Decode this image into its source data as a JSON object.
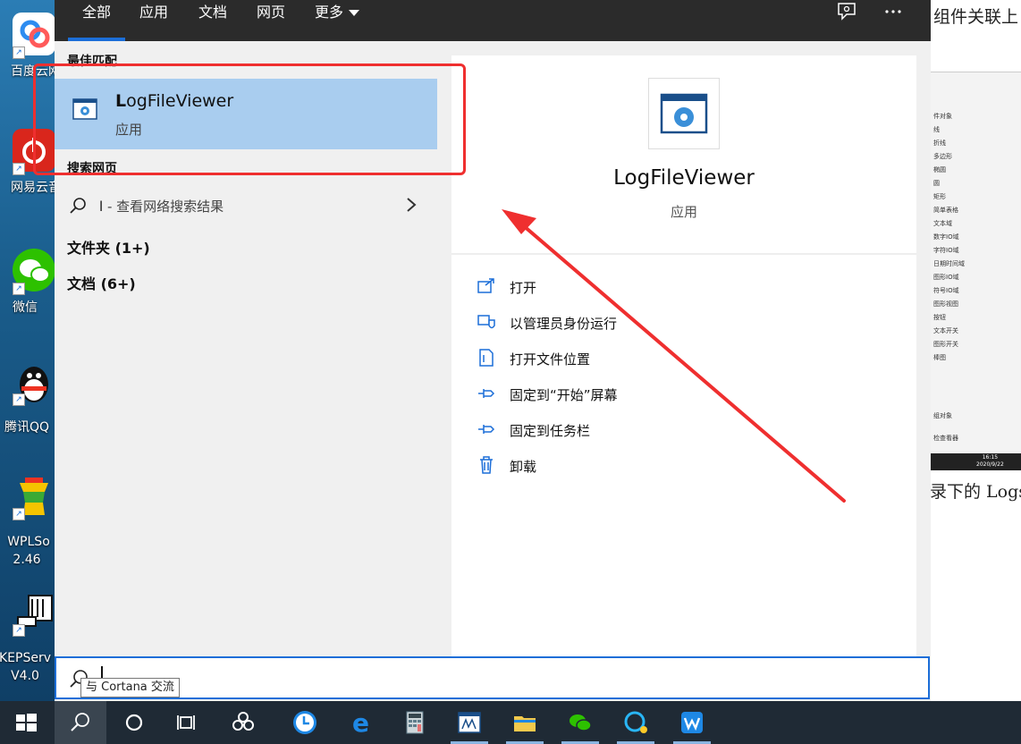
{
  "desktop_icons": [
    {
      "label": "百度云网",
      "icon": "baidu-netdisk-icon",
      "color": "#2d8cf0"
    },
    {
      "label": "网易云音",
      "icon": "netease-music-icon",
      "color": "#d9261c"
    },
    {
      "label": "微信",
      "icon": "wechat-icon",
      "color": "#2dc100"
    },
    {
      "label": "腾讯QQ",
      "icon": "qq-icon",
      "color": "#111111"
    },
    {
      "label": "WPLSo",
      "label2": "2.46",
      "icon": "wplsoft-icon",
      "color": "#f5c400"
    },
    {
      "label": "KEPServ",
      "label2": "V4.0",
      "icon": "kepserver-icon",
      "color": "#333333"
    }
  ],
  "background_doc": {
    "line1": "组件关联上",
    "line2": "录下的 Logs",
    "rows": [
      "件对象",
      "线",
      "折线",
      "多边形",
      "椭圆",
      "圆",
      "矩形",
      "简单表格",
      "文本域",
      "数字IO域",
      "字符IO域",
      "日期时间域",
      "图形IO域",
      "符号IO域",
      "图形视图",
      "按钮",
      "文本开关",
      "图形开关",
      "棒图",
      "组对象",
      "检查看器"
    ],
    "clock": "16:15",
    "date": "2020/9/22"
  },
  "tabs": [
    {
      "label": "全部",
      "active": true
    },
    {
      "label": "应用"
    },
    {
      "label": "文档"
    },
    {
      "label": "网页"
    },
    {
      "label": "更多"
    }
  ],
  "left": {
    "best_match_header": "最佳匹配",
    "best_match": {
      "name_bold": "L",
      "name_rest": "ogFileViewer",
      "kind": "应用"
    },
    "search_web_header": "搜索网页",
    "web_query": "l",
    "web_suffix": " - 查看网络搜索结果",
    "folders": "文件夹 (1+)",
    "documents": "文档 (6+)"
  },
  "right": {
    "app_name": "LogFileViewer",
    "app_kind": "应用",
    "actions": [
      {
        "label": "打开",
        "icon": "open-icon"
      },
      {
        "label": "以管理员身份运行",
        "icon": "admin-shield-icon"
      },
      {
        "label": "打开文件位置",
        "icon": "file-location-icon"
      },
      {
        "label": "固定到“开始”屏幕",
        "icon": "pin-start-icon"
      },
      {
        "label": "固定到任务栏",
        "icon": "pin-taskbar-icon"
      },
      {
        "label": "卸载",
        "icon": "trash-icon"
      }
    ]
  },
  "search": {
    "value": "l",
    "tooltip": "与 Cortana 交流"
  },
  "colors": {
    "accent": "#1c6ed8",
    "selection": "#a9cdef",
    "annotation": "#ef2f2f",
    "taskbar": "#1f2a35"
  }
}
